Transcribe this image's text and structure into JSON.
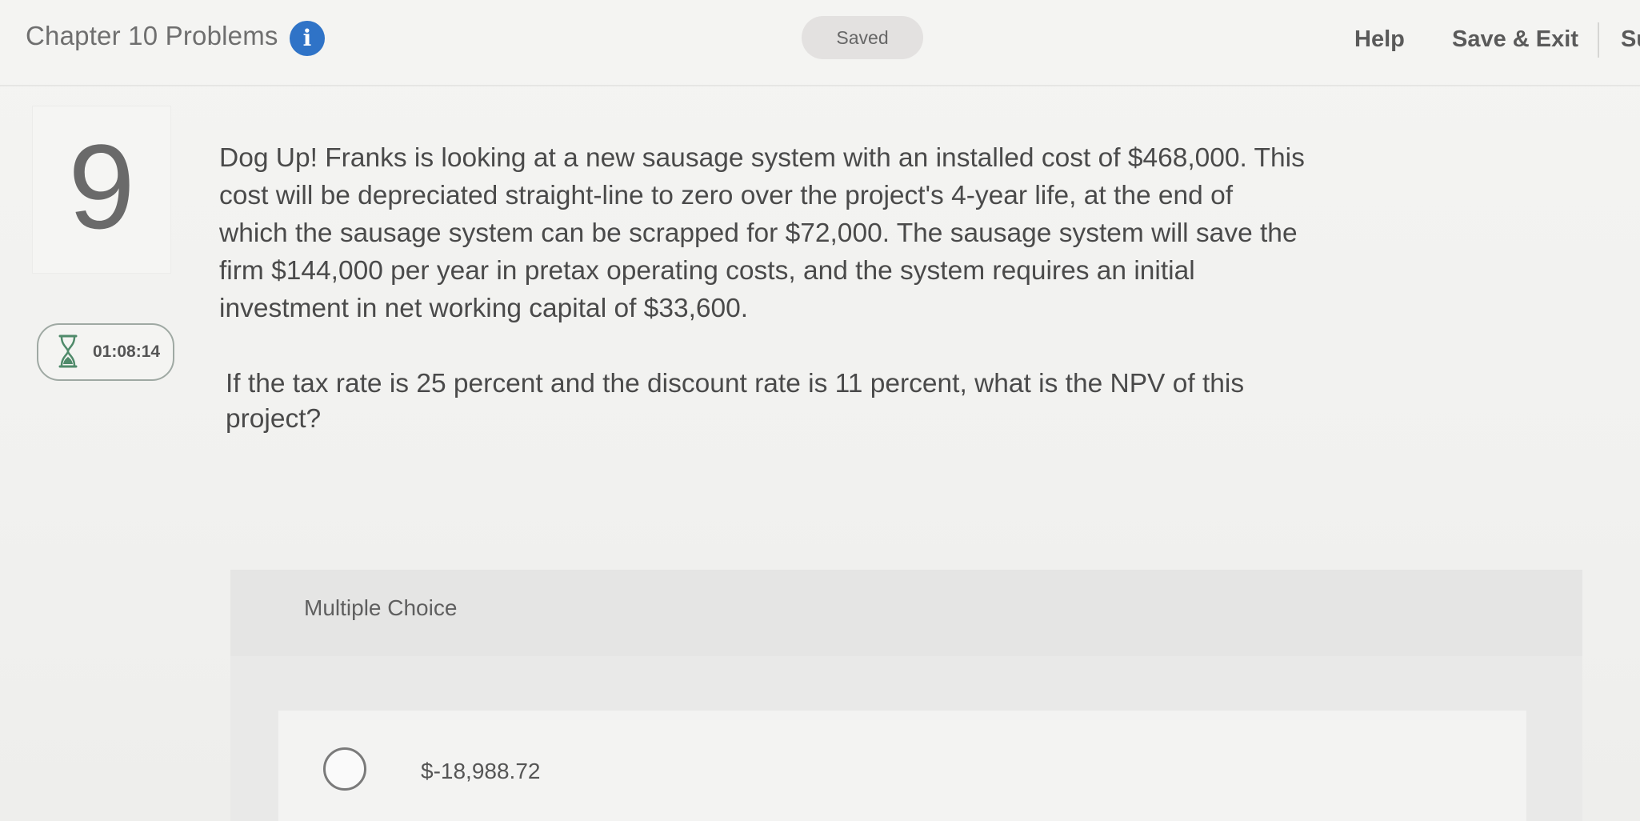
{
  "header": {
    "title": "Chapter 10 Problems",
    "info_icon": "info-icon",
    "status": "Saved",
    "links": {
      "help": "Help",
      "save_exit": "Save & Exit",
      "submit": "Su"
    }
  },
  "question": {
    "number": "9",
    "timer": "01:08:14",
    "text": "Dog Up! Franks is looking at a new sausage system with an installed cost of $468,000. This cost will be depreciated straight-line to zero over the project's 4-year life, at the end of which the sausage system can be scrapped for $72,000. The sausage system will save the firm $144,000 per year in pretax operating costs, and the system requires an initial investment in net working capital of $33,600.",
    "prompt": "If the tax rate is 25 percent and the discount rate is 11 percent, what is the NPV of this project?"
  },
  "answer": {
    "type_label": "Multiple Choice",
    "options": [
      {
        "label": "$-18,988.72",
        "selected": false
      }
    ]
  },
  "colors": {
    "accent": "#2f73c7",
    "background": "#f3f3f1",
    "text": "#4a4a4a"
  }
}
